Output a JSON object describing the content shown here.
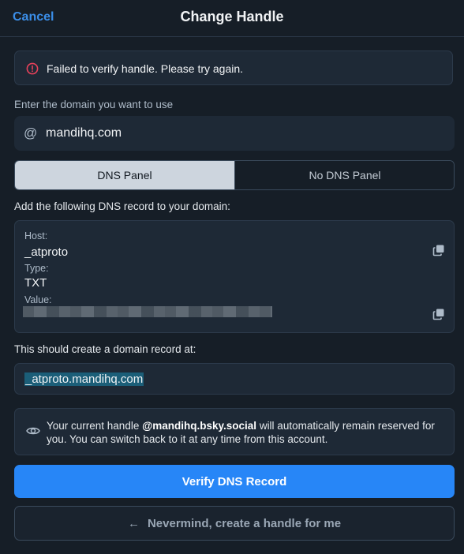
{
  "header": {
    "cancel_label": "Cancel",
    "title": "Change Handle"
  },
  "error": {
    "message": "Failed to verify handle. Please try again."
  },
  "domain_section": {
    "label": "Enter the domain you want to use",
    "at_symbol": "@",
    "value": "mandihq.com"
  },
  "tabs": [
    {
      "label": "DNS Panel",
      "selected": true
    },
    {
      "label": "No DNS Panel",
      "selected": false
    }
  ],
  "dns_instructions": "Add the following DNS record to your domain:",
  "record": {
    "host_label": "Host:",
    "host_value": "_atproto",
    "type_label": "Type:",
    "type_value": "TXT",
    "value_label": "Value:"
  },
  "result_label": "This should create a domain record at:",
  "result_value": "_atproto.mandihq.com",
  "info": {
    "prefix": "Your current handle ",
    "handle": "@mandihq.bsky.social",
    "suffix": " will automatically remain reserved for you. You can switch back to it at any time from this account."
  },
  "buttons": {
    "verify": "Verify DNS Record",
    "nevermind": "Nevermind, create a handle for me",
    "nevermind_arrow": "←"
  },
  "colors": {
    "accent": "#2786f7",
    "error": "#e8415b",
    "background": "#161e27",
    "card": "#1e2936"
  }
}
